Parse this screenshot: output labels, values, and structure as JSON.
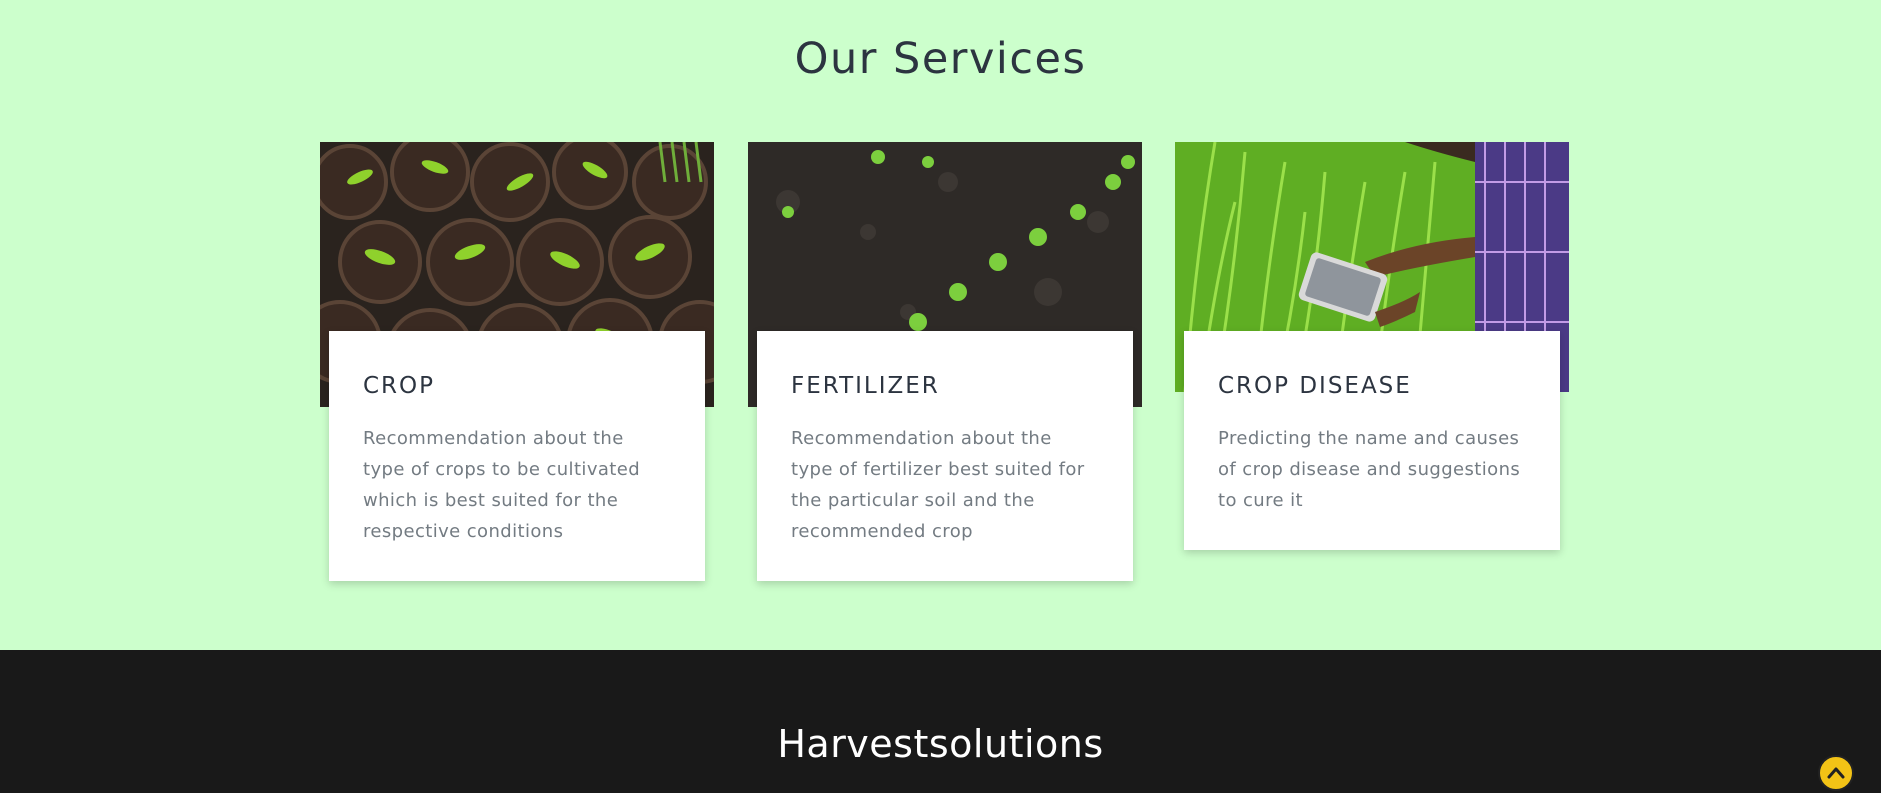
{
  "services": {
    "title": "Our Services",
    "cards": [
      {
        "title": "CROP",
        "description": "Recommendation about the type of crops to be cultivated which is best suited for the respective conditions",
        "image": "seedlings-in-pots"
      },
      {
        "title": "FERTILIZER",
        "description": "Recommendation about the type of fertilizer best suited for the particular soil and the recommended crop",
        "image": "sprouts-in-soil"
      },
      {
        "title": "CROP DISEASE",
        "description": "Predicting the name and causes of crop disease and suggestions to cure it",
        "image": "farmer-with-tablet-in-rice-field"
      }
    ]
  },
  "footer": {
    "brand": "Harvestsolutions"
  },
  "scroll_top": {
    "icon": "chevron-up-icon"
  },
  "colors": {
    "page_bg": "#ccffcc",
    "footer_bg": "#191919",
    "heading": "#2c3440",
    "body_text": "#737b82",
    "accent": "#f3c316"
  }
}
